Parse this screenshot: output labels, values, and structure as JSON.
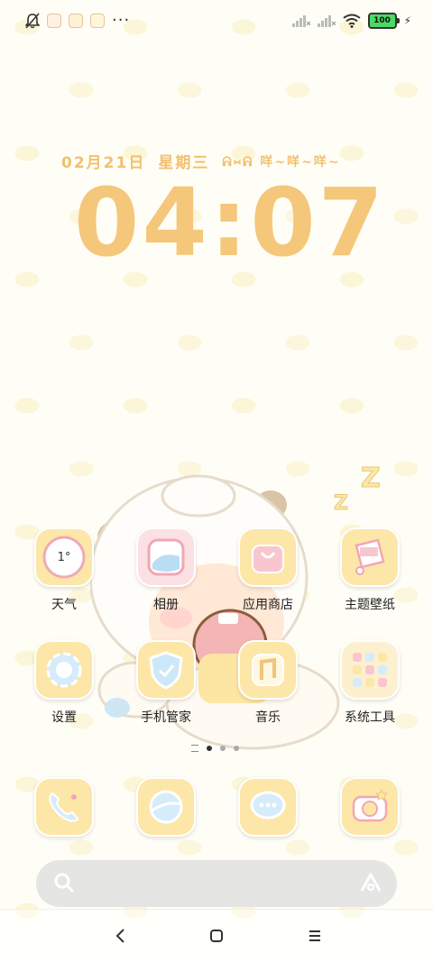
{
  "status_bar": {
    "notification_icons": [
      "bell-off-icon",
      "app-icon-1",
      "app-icon-2",
      "app-icon-3"
    ],
    "more_dots": "···",
    "signal_icons": [
      "signal-icon-1",
      "signal-icon-2"
    ],
    "wifi_icon": "wifi-icon",
    "battery_level": "100",
    "charging_icon": "bolt-icon"
  },
  "clock": {
    "date": "02月21日",
    "weekday": "星期三",
    "greeting": "ᕱ⑅ᕱ 咩~咩~咩~",
    "time": "04:07"
  },
  "apps": [
    {
      "label": "天气",
      "tile_text": "1°"
    },
    {
      "label": "相册"
    },
    {
      "label": "应用商店"
    },
    {
      "label": "主题壁纸"
    },
    {
      "label": "设置"
    },
    {
      "label": "手机管家"
    },
    {
      "label": "音乐"
    },
    {
      "label": "系统工具"
    }
  ],
  "dock": [
    {
      "name": "phone"
    },
    {
      "name": "browser"
    },
    {
      "name": "messages"
    },
    {
      "name": "camera"
    }
  ],
  "pager": {
    "pages": 3,
    "active_page": 1
  },
  "colors": {
    "accent": "#f5c77b",
    "tile_bg": "#fde7a8",
    "wallpaper": "#fffef6"
  }
}
